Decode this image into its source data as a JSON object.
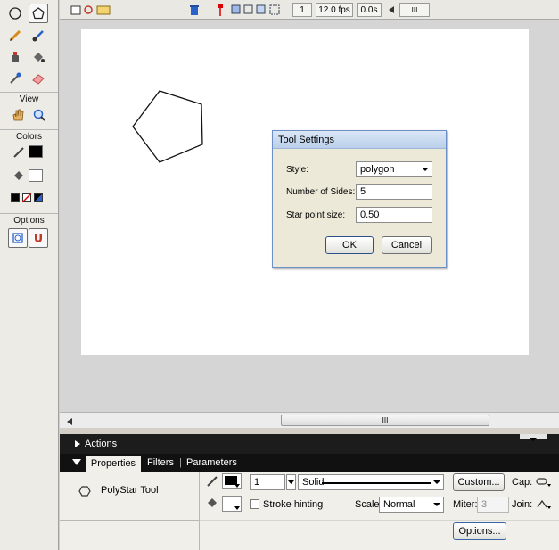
{
  "tools_view_label": "View",
  "tools_colors_label": "Colors",
  "tools_options_label": "Options",
  "timeline": {
    "frame": "1",
    "fps": "12.0 fps",
    "time": "0.0s",
    "scroll_glyph": "III"
  },
  "hscroll_glyph": "III",
  "actions_label": "Actions",
  "tabs": {
    "properties": "Properties",
    "filters": "Filters",
    "parameters": "Parameters",
    "sep": "|"
  },
  "props": {
    "tool_name": "PolyStar Tool",
    "stroke_height": "1",
    "stroke_style": "Solid",
    "custom_button": "Custom...",
    "cap_label": "Cap:",
    "stroke_hinting_label": "Stroke hinting",
    "scale_label": "Scale:",
    "scale_value": "Normal",
    "miter_label": "Miter:",
    "miter_value": "3",
    "join_label": "Join:",
    "options_button": "Options..."
  },
  "dialog": {
    "title": "Tool Settings",
    "style_label": "Style:",
    "style_value": "polygon",
    "sides_label": "Number of Sides:",
    "sides_value": "5",
    "star_label": "Star point size:",
    "star_value": "0.50",
    "ok": "OK",
    "cancel": "Cancel"
  }
}
